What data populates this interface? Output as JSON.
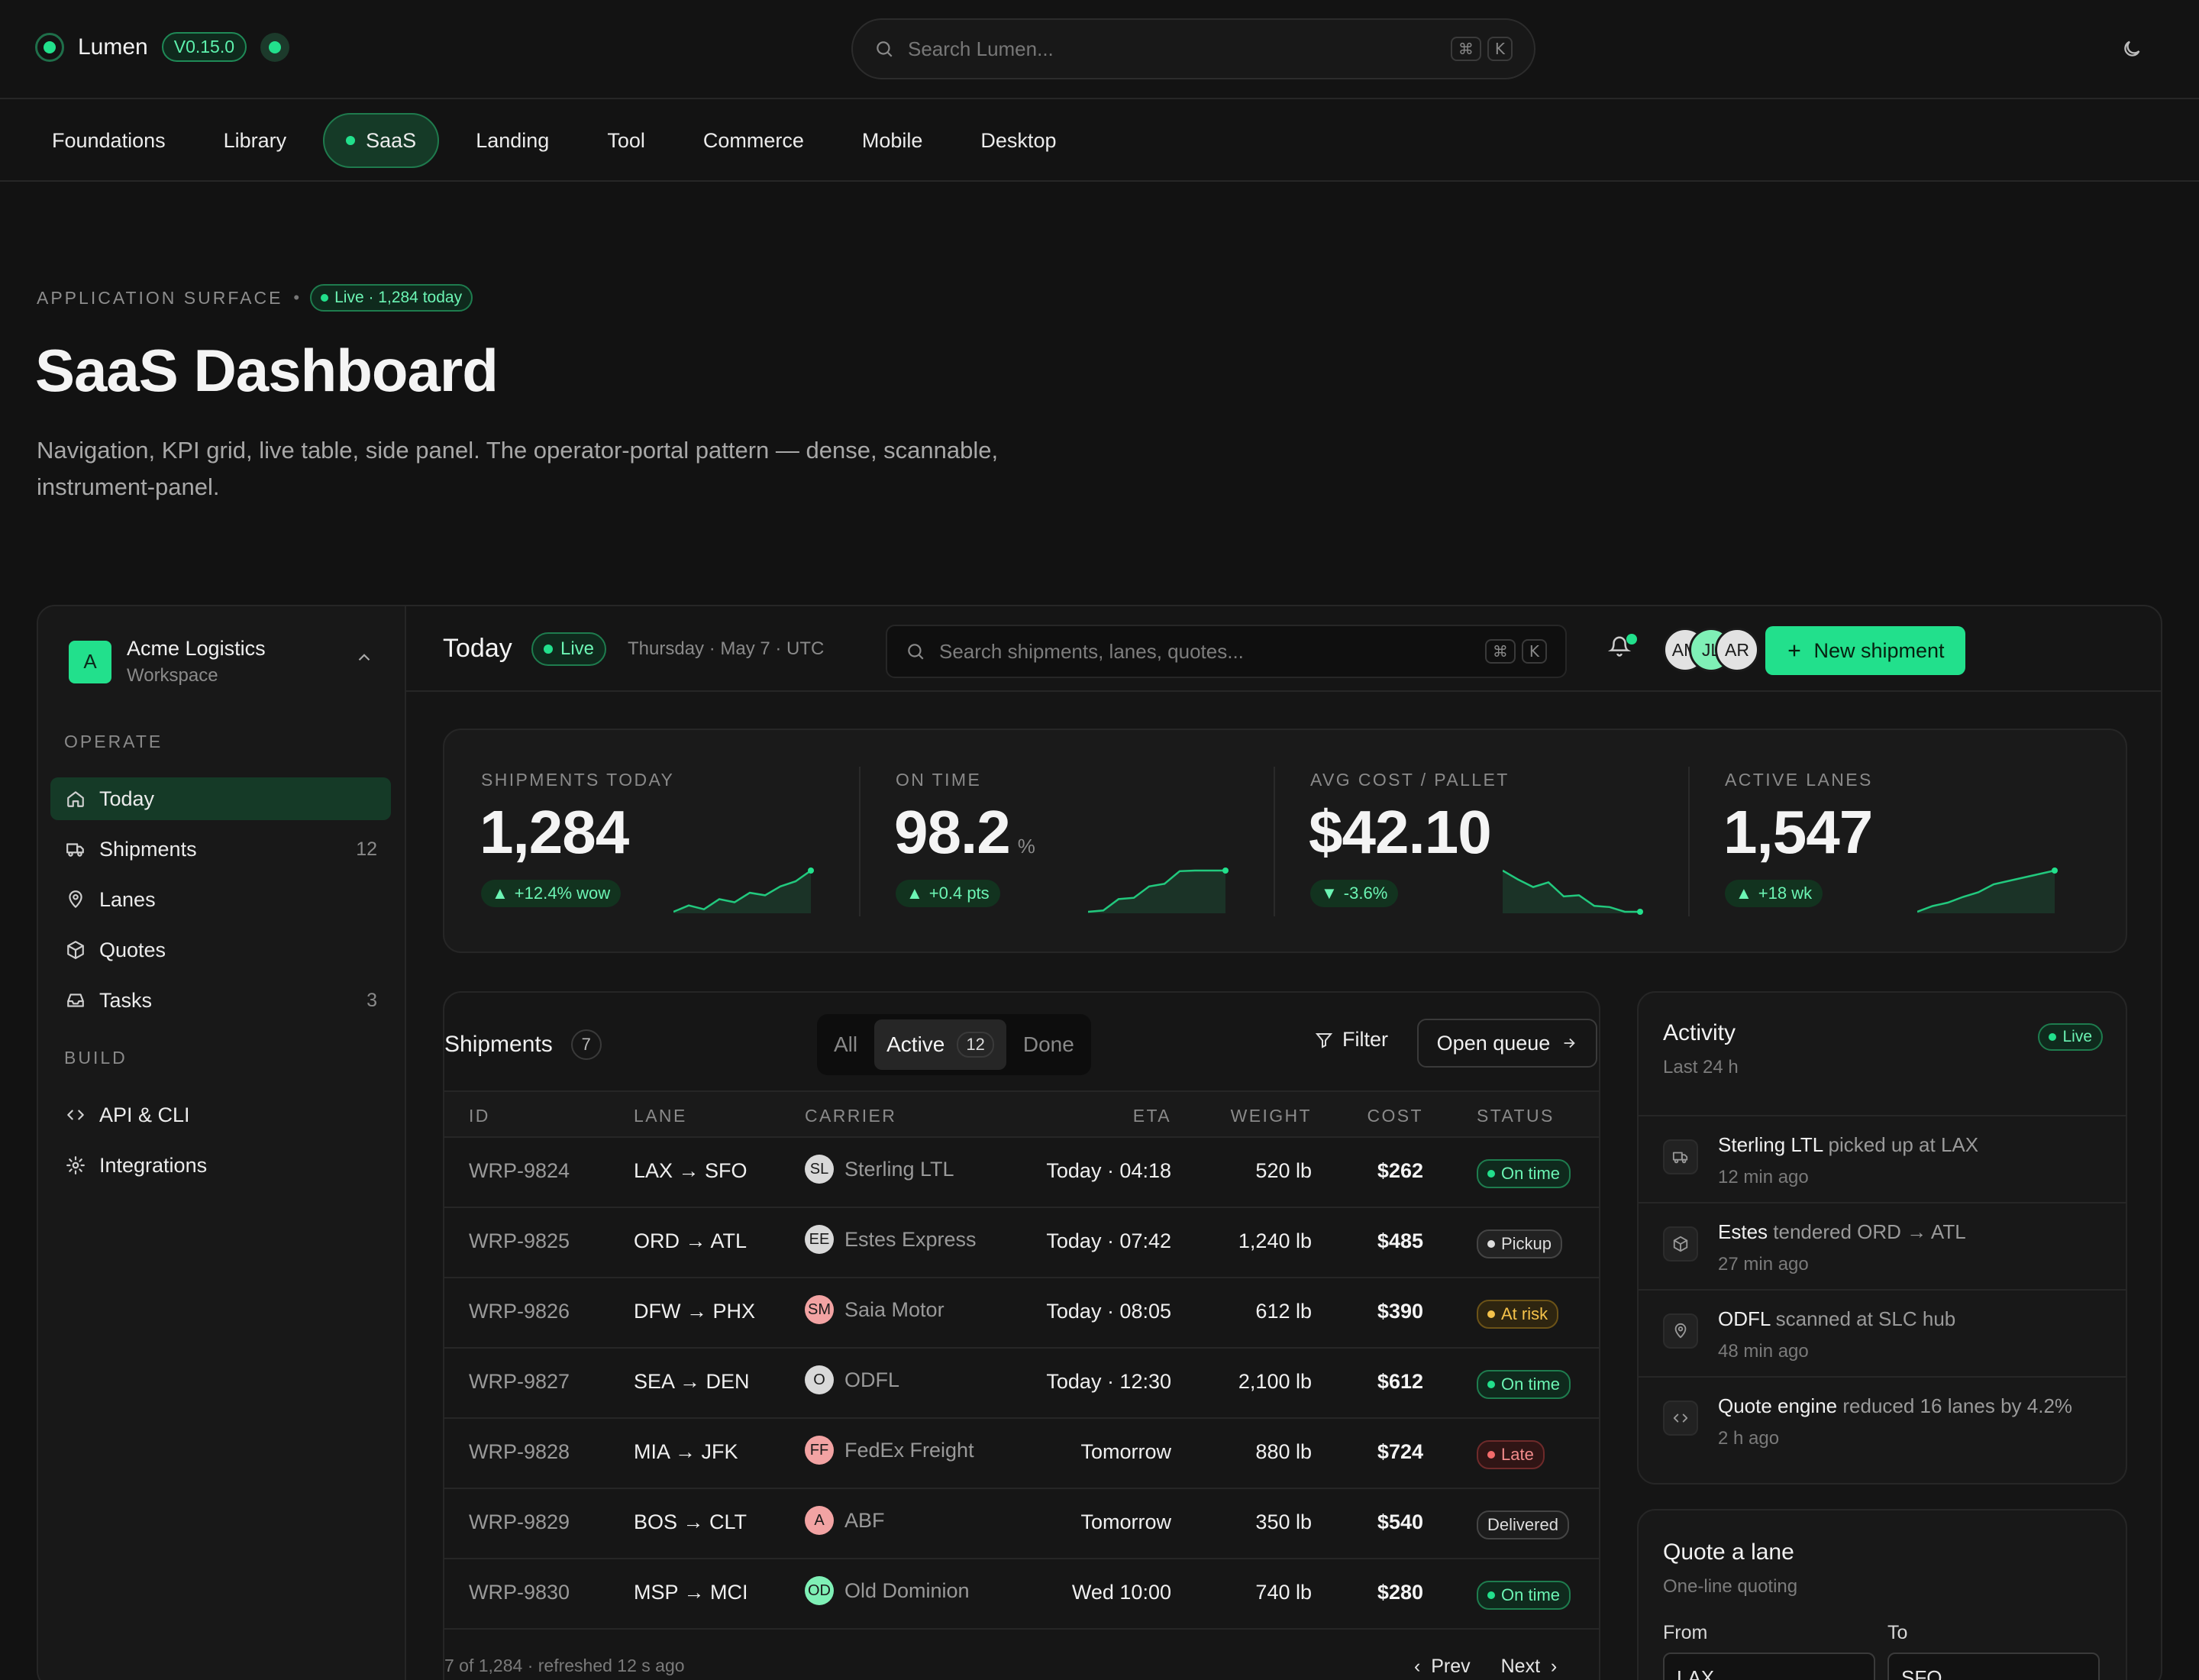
{
  "brand": {
    "name": "Lumen",
    "version": "V0.15.0"
  },
  "top_search": {
    "placeholder": "Search Lumen...",
    "kbd": [
      "⌘",
      "K"
    ]
  },
  "nav_tabs": [
    {
      "label": "Foundations",
      "active": false
    },
    {
      "label": "Library",
      "active": false
    },
    {
      "label": "SaaS",
      "active": true
    },
    {
      "label": "Landing",
      "active": false
    },
    {
      "label": "Tool",
      "active": false
    },
    {
      "label": "Commerce",
      "active": false
    },
    {
      "label": "Mobile",
      "active": false
    },
    {
      "label": "Desktop",
      "active": false
    }
  ],
  "hero": {
    "eyebrow": "APPLICATION SURFACE",
    "live_pill": "Live · 1,284 today",
    "title": "SaaS Dashboard",
    "subtitle": "Navigation, KPI grid, live table, side panel. The operator-portal pattern — dense, scannable, instrument-panel."
  },
  "sidebar": {
    "workspace": {
      "logo": "A",
      "name": "Acme Logistics",
      "sub": "Workspace"
    },
    "operate_label": "OPERATE",
    "operate": [
      {
        "label": "Today",
        "icon": "home-icon",
        "count": ""
      },
      {
        "label": "Shipments",
        "icon": "truck-icon",
        "count": "12"
      },
      {
        "label": "Lanes",
        "icon": "pin-icon",
        "count": ""
      },
      {
        "label": "Quotes",
        "icon": "box-icon",
        "count": ""
      },
      {
        "label": "Tasks",
        "icon": "inbox-icon",
        "count": "3"
      }
    ],
    "build_label": "BUILD",
    "build": [
      {
        "label": "API & CLI",
        "icon": "code-icon"
      },
      {
        "label": "Integrations",
        "icon": "gear-icon"
      }
    ]
  },
  "header": {
    "title": "Today",
    "live": "Live",
    "date": "Thursday · May 7 · UTC",
    "search_placeholder": "Search shipments, lanes, quotes...",
    "kbd": [
      "⌘",
      "K"
    ],
    "avatars": [
      "AM",
      "JL",
      "AR"
    ],
    "new_button": "New shipment"
  },
  "kpis": [
    {
      "label": "SHIPMENTS TODAY",
      "value": "1,284",
      "unit": "",
      "delta": "+12.4% wow",
      "dir": "up",
      "spark": [
        2,
        3,
        2.4,
        4,
        3.5,
        5,
        4.6,
        6,
        6.8,
        8.5
      ]
    },
    {
      "label": "ON TIME",
      "value": "98.2",
      "unit": "%",
      "delta": "+0.4 pts",
      "dir": "up",
      "spark": [
        1,
        1.2,
        3,
        3.2,
        5,
        5.4,
        7.4,
        7.5,
        7.5,
        7.5
      ]
    },
    {
      "label": "AVG COST / PALLET",
      "value": "$42.10",
      "unit": "",
      "delta": "-3.6%",
      "dir": "down",
      "spark": [
        8,
        6.5,
        5.2,
        6,
        3.6,
        3.8,
        2,
        1.8,
        1,
        1
      ]
    },
    {
      "label": "ACTIVE LANES",
      "value": "1,547",
      "unit": "",
      "delta": "+18 wk",
      "dir": "up",
      "spark": [
        1,
        2,
        2.6,
        3.6,
        4.4,
        5.8,
        6.4,
        7,
        7.6,
        8.2
      ]
    }
  ],
  "shipments": {
    "title": "Shipments",
    "count": "7",
    "segments": [
      {
        "label": "All",
        "count": ""
      },
      {
        "label": "Active",
        "count": "12"
      },
      {
        "label": "Done",
        "count": ""
      }
    ],
    "filter": "Filter",
    "open_queue": "Open queue",
    "columns": [
      "ID",
      "LANE",
      "CARRIER",
      "ETA",
      "WEIGHT",
      "COST",
      "STATUS"
    ],
    "rows": [
      {
        "id": "WRP-9824",
        "lane": "LAX → SFO",
        "carrier_initials": "SL",
        "carrier": "Sterling LTL",
        "carrier_color": "#d9d9d9",
        "eta": "Today · 04:18",
        "weight": "520 lb",
        "cost": "$262",
        "status": "On time",
        "status_kind": "green"
      },
      {
        "id": "WRP-9825",
        "lane": "ORD → ATL",
        "carrier_initials": "EE",
        "carrier": "Estes Express",
        "carrier_color": "#d9d9d9",
        "eta": "Today · 07:42",
        "weight": "1,240 lb",
        "cost": "$485",
        "status": "Pickup",
        "status_kind": "gray"
      },
      {
        "id": "WRP-9826",
        "lane": "DFW → PHX",
        "carrier_initials": "SM",
        "carrier": "Saia Motor",
        "carrier_color": "#f2a3a3",
        "eta": "Today · 08:05",
        "weight": "612 lb",
        "cost": "$390",
        "status": "At risk",
        "status_kind": "amber"
      },
      {
        "id": "WRP-9827",
        "lane": "SEA → DEN",
        "carrier_initials": "O",
        "carrier": "ODFL",
        "carrier_color": "#d9d9d9",
        "eta": "Today · 12:30",
        "weight": "2,100 lb",
        "cost": "$612",
        "status": "On time",
        "status_kind": "green"
      },
      {
        "id": "WRP-9828",
        "lane": "MIA → JFK",
        "carrier_initials": "FF",
        "carrier": "FedEx Freight",
        "carrier_color": "#f2a3a3",
        "eta": "Tomorrow",
        "weight": "880 lb",
        "cost": "$724",
        "status": "Late",
        "status_kind": "red"
      },
      {
        "id": "WRP-9829",
        "lane": "BOS → CLT",
        "carrier_initials": "A",
        "carrier": "ABF",
        "carrier_color": "#f2a3a3",
        "eta": "Tomorrow",
        "weight": "350 lb",
        "cost": "$540",
        "status": "Delivered",
        "status_kind": "plain"
      },
      {
        "id": "WRP-9830",
        "lane": "MSP → MCI",
        "carrier_initials": "OD",
        "carrier": "Old Dominion",
        "carrier_color": "#7ff0b6",
        "eta": "Wed 10:00",
        "weight": "740 lb",
        "cost": "$280",
        "status": "On time",
        "status_kind": "green"
      }
    ],
    "footer": "7 of 1,284 · refreshed 12 s ago",
    "prev": "Prev",
    "next": "Next"
  },
  "activity": {
    "title": "Activity",
    "sub": "Last 24 h",
    "live": "Live",
    "items": [
      {
        "actor": "Sterling LTL",
        "text": "picked up at LAX",
        "time": "12 min ago",
        "icon": "truck-icon"
      },
      {
        "actor": "Estes",
        "text": "tendered ORD → ATL",
        "time": "27 min ago",
        "icon": "box-icon"
      },
      {
        "actor": "ODFL",
        "text": "scanned at SLC hub",
        "time": "48 min ago",
        "icon": "pin-icon"
      },
      {
        "actor": "Quote engine",
        "text": "reduced 16 lanes by 4.2%",
        "time": "2 h ago",
        "icon": "code-icon"
      }
    ]
  },
  "quote": {
    "title": "Quote a lane",
    "sub": "One-line quoting",
    "from_label": "From",
    "to_label": "To",
    "from_value": "LAX",
    "to_value": "SFO"
  },
  "colors": {
    "accent": "#22e08c",
    "background": "#121212",
    "panel": "#181818"
  }
}
